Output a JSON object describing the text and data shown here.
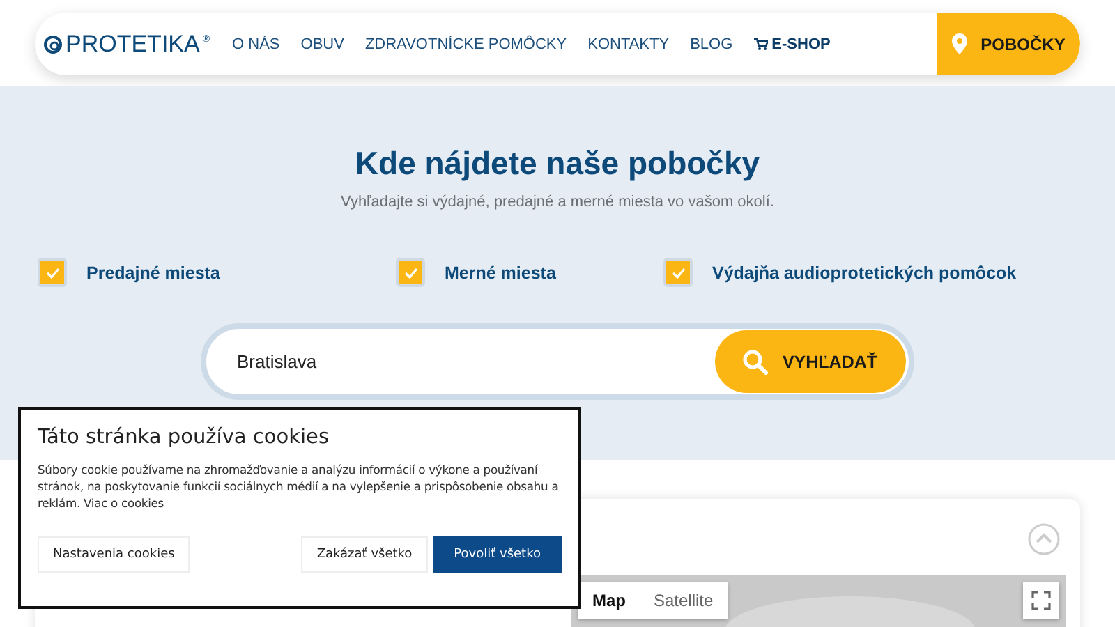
{
  "header": {
    "logo": {
      "text": "PROTETIKA",
      "mark": "®"
    },
    "nav": [
      {
        "label": "O NÁS",
        "kind": "link"
      },
      {
        "label": "OBUV",
        "kind": "link"
      },
      {
        "label": "ZDRAVOTNÍCKE POMÔCKY",
        "kind": "link"
      },
      {
        "label": "KONTAKTY",
        "kind": "link"
      },
      {
        "label": "BLOG",
        "kind": "link"
      },
      {
        "label": "E-SHOP",
        "kind": "shop"
      }
    ],
    "branches_button": "POBOČKY"
  },
  "hero": {
    "title": "Kde nájdete naše pobočky",
    "subtitle": "Vyhľadajte si výdajné, predajné a merné miesta vo vašom okolí.",
    "filters": [
      {
        "label": "Predajné miesta",
        "checked": true
      },
      {
        "label": "Merné miesta",
        "checked": true
      },
      {
        "label": "Výdajňa audioprotetických pomôcok",
        "checked": true
      }
    ],
    "search": {
      "value": "Bratislava",
      "button": "VYHĽADAŤ"
    }
  },
  "map": {
    "types": [
      {
        "label": "Map",
        "selected": true
      },
      {
        "label": "Satellite",
        "selected": false
      }
    ]
  },
  "cookie_dialog": {
    "title": "Táto stránka používa cookies",
    "text": "Súbory cookie používame na zhromažďovanie a analýzu informácií o výkone a používaní stránok, na poskytovanie funkcií sociálnych médií a na vylepšenie a prispôsobenie obsahu a reklám.",
    "link": "Viac o cookies",
    "buttons": [
      {
        "label": "Nastavenia cookies",
        "kind": "plain"
      },
      {
        "label": "Zakázať všetko",
        "kind": "plain"
      },
      {
        "label": "Povoliť všetko",
        "kind": "primary"
      }
    ]
  }
}
